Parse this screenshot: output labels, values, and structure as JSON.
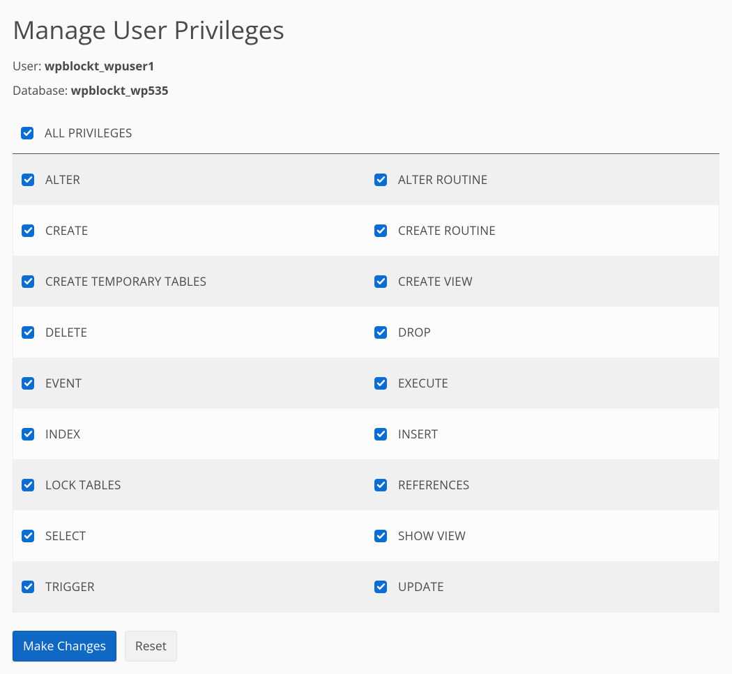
{
  "title": "Manage User Privileges",
  "user_label": "User: ",
  "user_value": "wpblockt_wpuser1",
  "db_label": "Database: ",
  "db_value": "wpblockt_wp535",
  "all_privileges": {
    "label": "ALL PRIVILEGES",
    "checked": true
  },
  "privileges": [
    {
      "label": "ALTER",
      "checked": true
    },
    {
      "label": "ALTER ROUTINE",
      "checked": true
    },
    {
      "label": "CREATE",
      "checked": true
    },
    {
      "label": "CREATE ROUTINE",
      "checked": true
    },
    {
      "label": "CREATE TEMPORARY TABLES",
      "checked": true
    },
    {
      "label": "CREATE VIEW",
      "checked": true
    },
    {
      "label": "DELETE",
      "checked": true
    },
    {
      "label": "DROP",
      "checked": true
    },
    {
      "label": "EVENT",
      "checked": true
    },
    {
      "label": "EXECUTE",
      "checked": true
    },
    {
      "label": "INDEX",
      "checked": true
    },
    {
      "label": "INSERT",
      "checked": true
    },
    {
      "label": "LOCK TABLES",
      "checked": true
    },
    {
      "label": "REFERENCES",
      "checked": true
    },
    {
      "label": "SELECT",
      "checked": true
    },
    {
      "label": "SHOW VIEW",
      "checked": true
    },
    {
      "label": "TRIGGER",
      "checked": true
    },
    {
      "label": "UPDATE",
      "checked": true
    }
  ],
  "buttons": {
    "make_changes": "Make Changes",
    "reset": "Reset"
  },
  "colors": {
    "checkbox": "#0a6dd4",
    "primary_button": "#1068c5"
  }
}
